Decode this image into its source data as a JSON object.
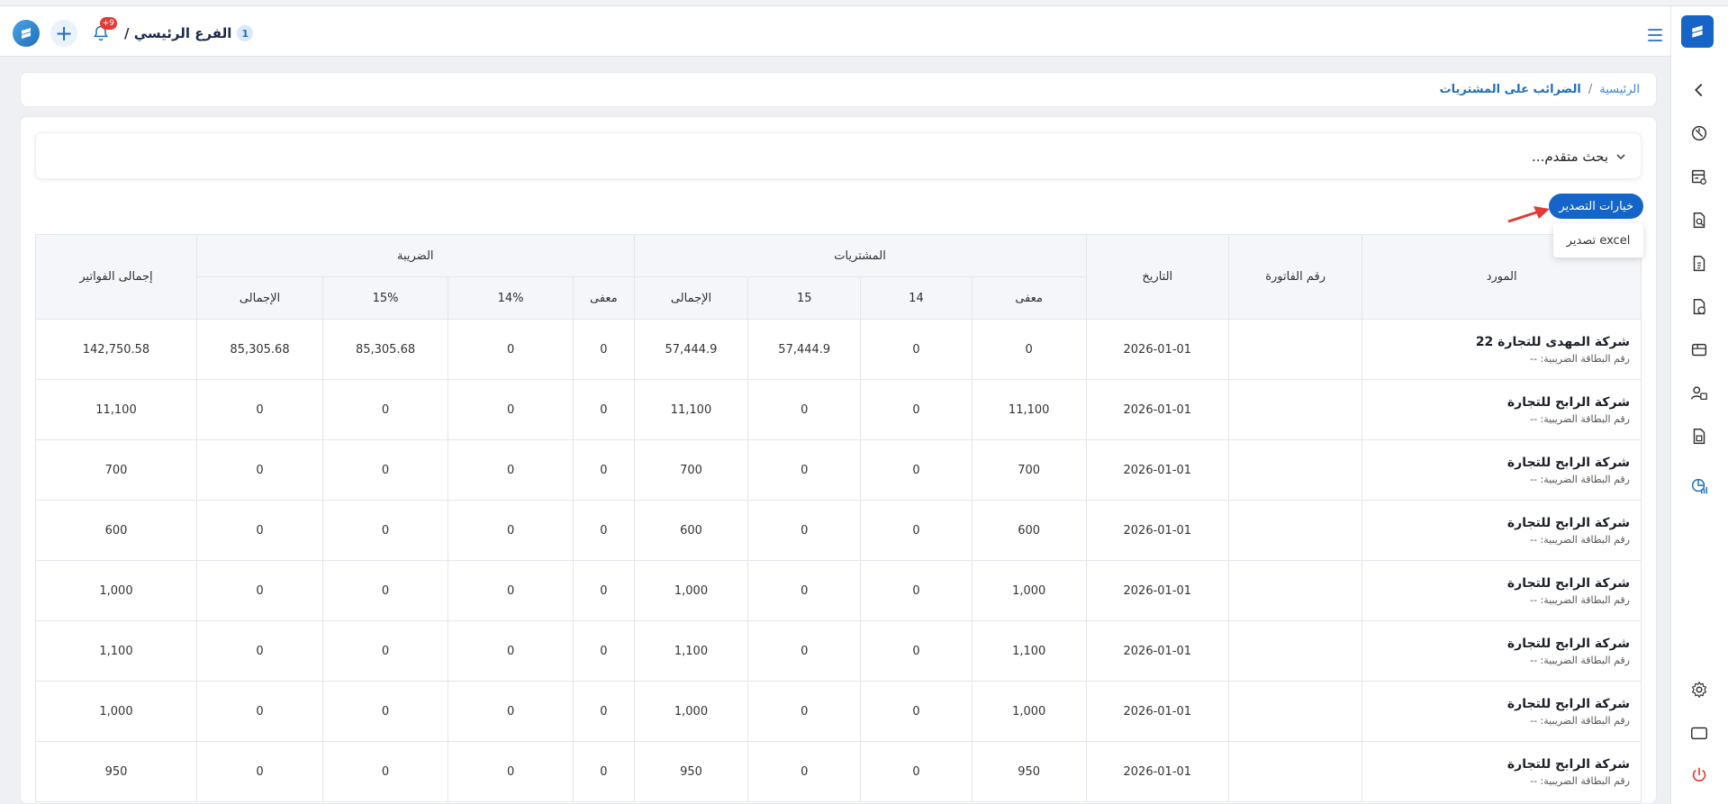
{
  "topbar": {
    "branch_label": "الفرع الرئيسي /",
    "branch_number": "1",
    "notification_count": "+9"
  },
  "breadcrumb": {
    "home": "الرئيسية",
    "separator": "/",
    "current": "الضرائب على المشتريات"
  },
  "advanced_search": {
    "label": "بحث متقدم..."
  },
  "export": {
    "button_label": "خيارات التصدير",
    "menu_item": "تصدير excel"
  },
  "table": {
    "headers": {
      "supplier": "المورد",
      "invoice_number": "رقم الفاتورة",
      "date": "التاريخ",
      "purchases_group": "المشتريات",
      "tax_group": "الضريبة",
      "invoices_total": "إجمالى الفواتير",
      "purchases_sub": [
        "معفى",
        "14",
        "15",
        "الإجمالى"
      ],
      "tax_sub": [
        "معفى",
        "14%",
        "15%",
        "الإجمالى"
      ]
    },
    "tax_card_prefix": "رقم البطاقة الضريبية: --",
    "rows": [
      {
        "supplier": "شركة المهدى للتجارة 22",
        "tax_card": "رقم البطاقة الضريبية: --",
        "invoice": "",
        "date": "2026-01-01",
        "p_exempt": "0",
        "p_14": "0",
        "p_15": "57,444.9",
        "p_total": "57,444.9",
        "t_exempt": "0",
        "t_14": "0",
        "t_15": "85,305.68",
        "t_total": "85,305.68",
        "grand": "142,750.58"
      },
      {
        "supplier": "شركة الرابح للتجارة",
        "tax_card": "رقم البطاقة الضريبية: --",
        "invoice": "",
        "date": "2026-01-01",
        "p_exempt": "11,100",
        "p_14": "0",
        "p_15": "0",
        "p_total": "11,100",
        "t_exempt": "0",
        "t_14": "0",
        "t_15": "0",
        "t_total": "0",
        "grand": "11,100"
      },
      {
        "supplier": "شركة الرابح للتجارة",
        "tax_card": "رقم البطاقة الضريبية: --",
        "invoice": "",
        "date": "2026-01-01",
        "p_exempt": "700",
        "p_14": "0",
        "p_15": "0",
        "p_total": "700",
        "t_exempt": "0",
        "t_14": "0",
        "t_15": "0",
        "t_total": "0",
        "grand": "700"
      },
      {
        "supplier": "شركة الرابح للتجارة",
        "tax_card": "رقم البطاقة الضريبية: --",
        "invoice": "",
        "date": "2026-01-01",
        "p_exempt": "600",
        "p_14": "0",
        "p_15": "0",
        "p_total": "600",
        "t_exempt": "0",
        "t_14": "0",
        "t_15": "0",
        "t_total": "0",
        "grand": "600"
      },
      {
        "supplier": "شركة الرابح للتجارة",
        "tax_card": "رقم البطاقة الضريبية: --",
        "invoice": "",
        "date": "2026-01-01",
        "p_exempt": "1,000",
        "p_14": "0",
        "p_15": "0",
        "p_total": "1,000",
        "t_exempt": "0",
        "t_14": "0",
        "t_15": "0",
        "t_total": "0",
        "grand": "1,000"
      },
      {
        "supplier": "شركة الرابح للتجارة",
        "tax_card": "رقم البطاقة الضريبية: --",
        "invoice": "",
        "date": "2026-01-01",
        "p_exempt": "1,100",
        "p_14": "0",
        "p_15": "0",
        "p_total": "1,100",
        "t_exempt": "0",
        "t_14": "0",
        "t_15": "0",
        "t_total": "0",
        "grand": "1,100"
      },
      {
        "supplier": "شركة الرابح للتجارة",
        "tax_card": "رقم البطاقة الضريبية: --",
        "invoice": "",
        "date": "2026-01-01",
        "p_exempt": "1,000",
        "p_14": "0",
        "p_15": "0",
        "p_total": "1,000",
        "t_exempt": "0",
        "t_14": "0",
        "t_15": "0",
        "t_total": "0",
        "grand": "1,000"
      },
      {
        "supplier": "شركة الرابح للتجارة",
        "tax_card": "رقم البطاقة الضريبية: --",
        "invoice": "",
        "date": "2026-01-01",
        "p_exempt": "950",
        "p_14": "0",
        "p_15": "0",
        "p_total": "950",
        "t_exempt": "0",
        "t_14": "0",
        "t_15": "0",
        "t_total": "0",
        "grand": "950"
      }
    ]
  },
  "sidebar_icons": [
    "chevron-left-icon",
    "dashboard-icon",
    "pos-icon",
    "document-search-icon",
    "invoice-icon",
    "sales-report-icon",
    "inventory-icon",
    "users-icon",
    "purchases-icon",
    "tax-report-icon",
    "settings-icon",
    "window-icon",
    "power-icon"
  ],
  "colors": {
    "accent": "#1565c8",
    "danger": "#e53935"
  }
}
